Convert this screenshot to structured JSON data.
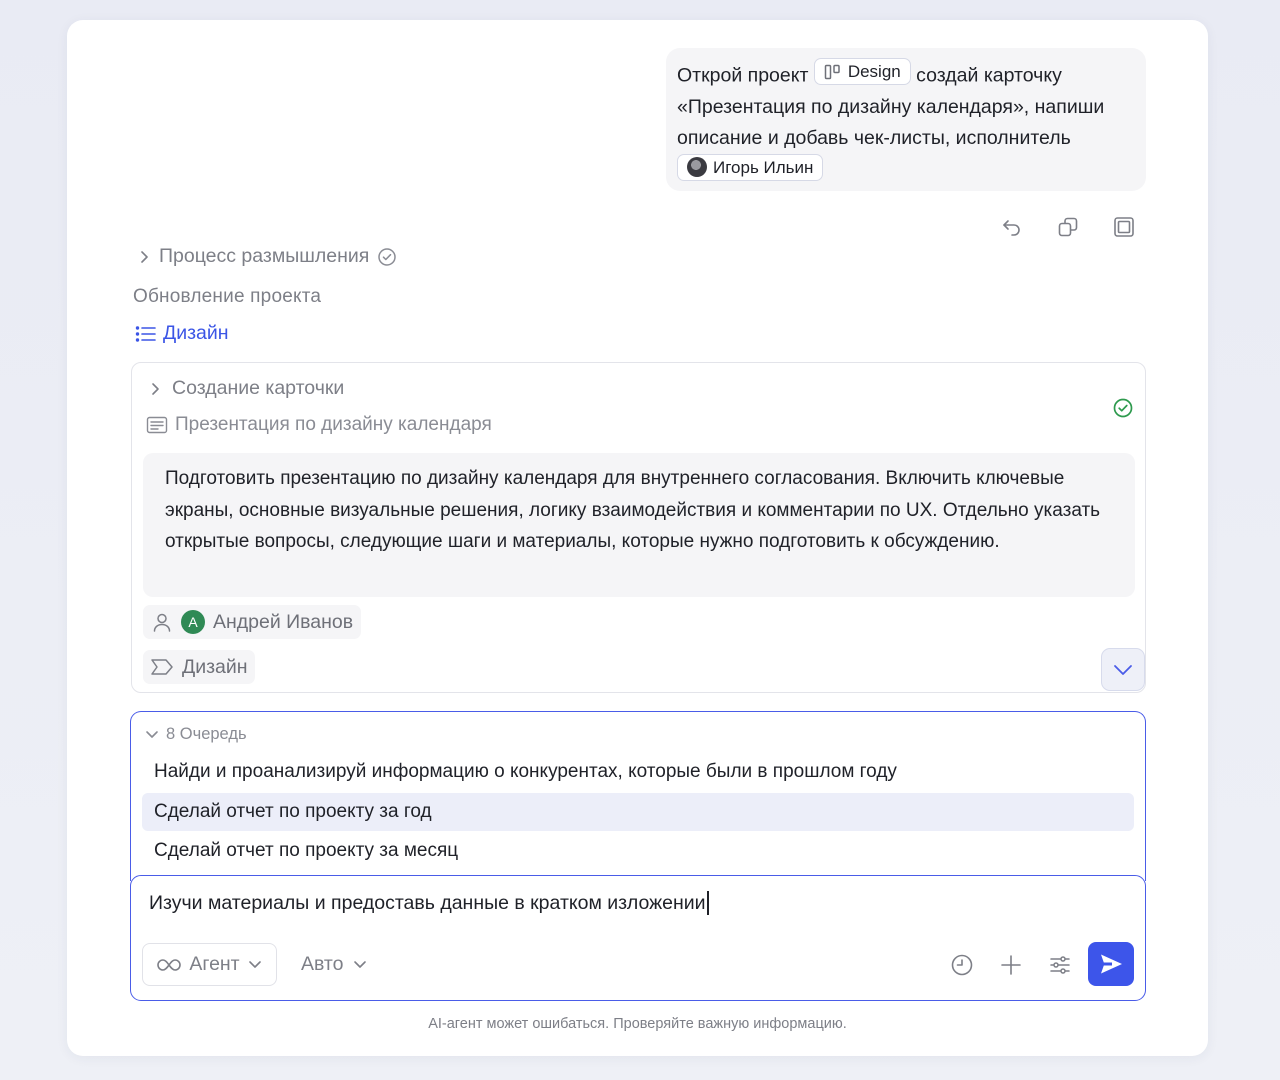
{
  "user_message": {
    "part1": "Открой проект",
    "project_chip": "Design",
    "part2": "создай карточку «Презентация по дизайну календаря», напиши описание и добавь чек-листы, исполнитель",
    "assignee_chip": "Игорь Ильин"
  },
  "message_actions": {
    "icons": [
      "undo-icon",
      "copy-icon",
      "window-icon"
    ]
  },
  "assistant": {
    "thinking_label": "Процесс размышления",
    "update_label": "Обновление  проекта",
    "project_link": "Дизайн"
  },
  "card": {
    "title": "Создание карточки",
    "card_name": "Презентация по дизайну календаря",
    "description": "Подготовить презентацию по дизайну календаря для внутреннего согласования. Включить ключевые экраны, основные визуальные решения, логику взаимодействия и комментарии по UX. Отдельно указать открытые вопросы, следующие шаги и материалы, которые нужно подготовить к обсуждению.",
    "assignee_initial": "А",
    "assignee_name": "Андрей Иванов",
    "tag": "Дизайн",
    "status_color": "#2e9a4e"
  },
  "queue": {
    "header": "8 Очередь",
    "items": [
      "Найди и проанализируй информацию о конкурентах, которые были в прошлом году",
      "Сделай отчет по проекту за год",
      "Сделай отчет по проекту за месяц"
    ]
  },
  "composer": {
    "input_value": "Изучи материалы и предоставь данные в кратком изложении",
    "mode_label": "Агент",
    "model_label": "Авто",
    "accent_color": "#3d55ea"
  },
  "footer": {
    "note": "AI-агент может ошибаться. Проверяйте важную информацию."
  }
}
